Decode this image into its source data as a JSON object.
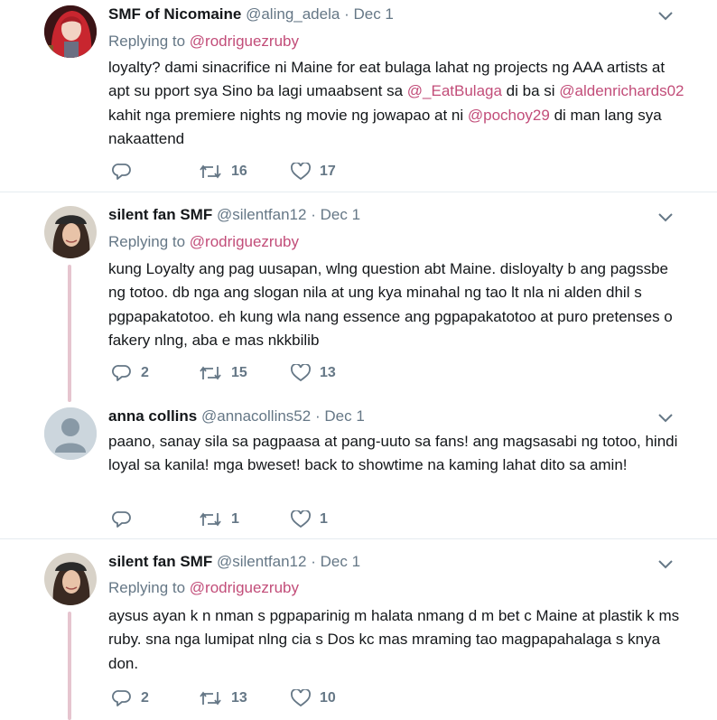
{
  "tweets": [
    {
      "name": "SMF of Nicomaine",
      "handle": "@aling_adela",
      "sep": "·",
      "date": "Dec 1",
      "replying_prefix": "Replying to",
      "replying_to": "@rodriguezruby",
      "body": {
        "p1": "loyalty? dami sinacrifice ni Maine for eat bulaga lahat ng projects ng AAA artists at apt su pport sya Sino ba lagi umaabsent sa ",
        "m1": "@_EatBulaga",
        "p2": " di ba si ",
        "m2": "@aldenrichards02",
        "p3": " kahit nga premiere nights ng movie ng jowapao at ni ",
        "m3": "@pochoy29",
        "p4": " di man lang sya nakaattend"
      },
      "replies": "",
      "retweets": "16",
      "likes": "17"
    },
    {
      "name": "silent fan SMF",
      "handle": "@silentfan12",
      "sep": "·",
      "date": "Dec 1",
      "replying_prefix": "Replying to",
      "replying_to": "@rodriguezruby",
      "body": "kung Loyalty ang pag uusapan, wlng question abt Maine. disloyalty b ang pagssbe ng totoo. db nga ang slogan nila at ung kya minahal ng tao lt nla ni alden dhil s pgpapakatotoo. eh kung wla nang essence ang pgpapakatotoo at puro pretenses o fakery nlng, aba e mas nkkbilib",
      "replies": "2",
      "retweets": "15",
      "likes": "13"
    },
    {
      "name": "anna collins",
      "handle": "@annacollins52",
      "sep": "·",
      "date": "Dec 1",
      "body": "paano, sanay sila sa pagpaasa at pang-uuto sa fans! ang magsasabi ng totoo, hindi loyal sa kanila! mga bweset! back to showtime na kaming lahat dito sa amin!",
      "replies": "",
      "retweets": "1",
      "likes": "1"
    },
    {
      "name": "silent fan SMF",
      "handle": "@silentfan12",
      "sep": "·",
      "date": "Dec 1",
      "replying_prefix": "Replying to",
      "replying_to": "@rodriguezruby",
      "body": "aysus ayan k n nman s pgpaparinig m halata nmang d m bet c Maine at plastik k ms ruby. sna nga lumipat nlng cia s Dos kc mas mraming tao magpapahalaga s knya don.",
      "replies": "2",
      "retweets": "13",
      "likes": "10"
    }
  ],
  "colors": {
    "mention": "#c24d79",
    "thread_line": "#e6c5cf",
    "meta": "#657786",
    "divider": "#e6ecf0"
  },
  "icons": [
    "reply-icon",
    "retweet-icon",
    "like-icon",
    "chevron-down-icon"
  ]
}
